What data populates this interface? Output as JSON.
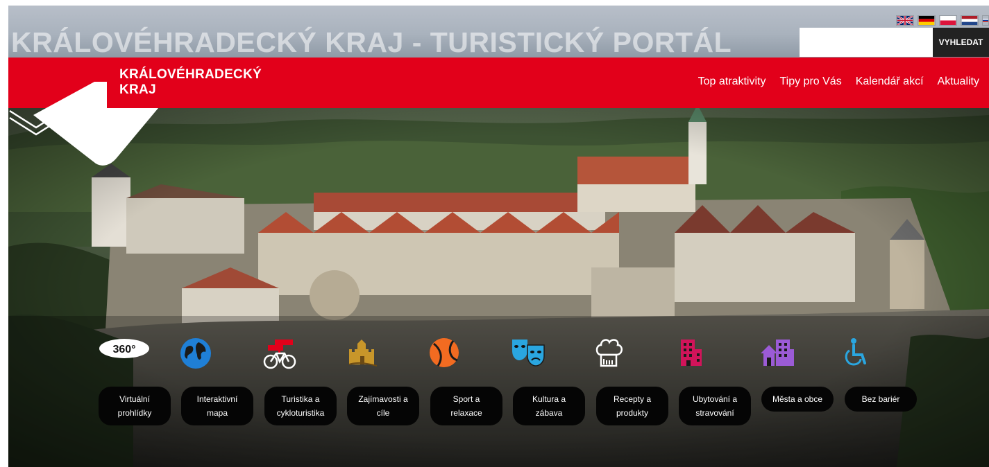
{
  "header": {
    "title": "KRÁLOVÉHRADECKÝ KRAJ - TURISTICKÝ PORTÁL",
    "logo_line1": "KRÁLOVÉHRADECKÝ",
    "logo_line2": "KRAJ",
    "search": {
      "placeholder": "",
      "value": "",
      "button_label": "VYHLEDAT"
    },
    "languages": [
      {
        "code": "en",
        "icon": "uk-flag-icon"
      },
      {
        "code": "de",
        "icon": "german-flag-icon"
      },
      {
        "code": "pl",
        "icon": "polish-flag-icon"
      },
      {
        "code": "nl",
        "icon": "dutch-flag-icon"
      },
      {
        "code": "ru",
        "icon": "russian-flag-icon"
      }
    ]
  },
  "nav": {
    "items": [
      "Top atraktivity",
      "Tipy pro Vás",
      "Kalendář akcí",
      "Aktuality"
    ]
  },
  "categories": [
    {
      "line1": "Virtuální",
      "line2": "prohlídky",
      "icon": "360-icon",
      "color": "#ffffff"
    },
    {
      "line1": "Interaktivní",
      "line2": "mapa",
      "icon": "globe-icon",
      "color": "#1f7fd6"
    },
    {
      "line1": "Turistika a",
      "line2": "cykloturistika",
      "icon": "bicycle-signpost-icon",
      "color": "#ffffff"
    },
    {
      "line1": "Zajímavosti a",
      "line2": "cíle",
      "icon": "castle-icon",
      "color": "#c8962a"
    },
    {
      "line1": "Sport a",
      "line2": "relaxace",
      "icon": "ball-icon",
      "color": "#f26b21"
    },
    {
      "line1": "Kultura a",
      "line2": "zábava",
      "icon": "theatre-masks-icon",
      "color": "#2aa6e0"
    },
    {
      "line1": "Recepty a",
      "line2": "produkty",
      "icon": "chef-hat-icon",
      "color": "#ffffff"
    },
    {
      "line1": "Ubytování a",
      "line2": "stravování",
      "icon": "hotel-icon",
      "color": "#d1145a"
    },
    {
      "line1": "Města a obce",
      "line2": "",
      "icon": "town-buildings-icon",
      "color": "#9b5bd6"
    },
    {
      "line1": "Bez bariér",
      "line2": "",
      "icon": "wheelchair-icon",
      "color": "#2aa6e0"
    }
  ],
  "colors": {
    "brand_red": "#e2001a",
    "search_button": "#222222"
  }
}
